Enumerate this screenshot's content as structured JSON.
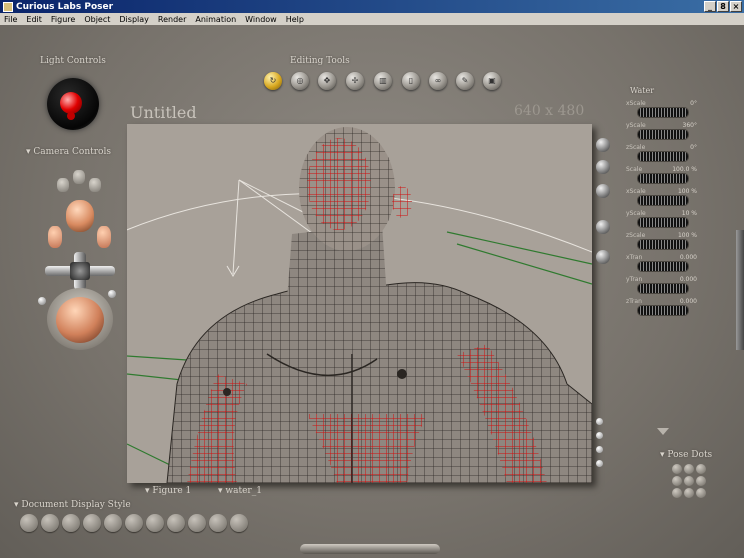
{
  "window": {
    "title": "Curious Labs Poser",
    "minimize": "_",
    "maximize": "8",
    "close": "×"
  },
  "menu": [
    "File",
    "Edit",
    "Figure",
    "Object",
    "Display",
    "Render",
    "Animation",
    "Window",
    "Help"
  ],
  "light_controls": {
    "label": "Light Controls"
  },
  "editing_tools": {
    "label": "Editing Tools",
    "tools": [
      "rotate-icon",
      "twist-icon",
      "translate-icon",
      "translate-in-out-icon",
      "scale-icon",
      "taper-icon",
      "chain-break-icon",
      "color-icon",
      "grouping-icon"
    ]
  },
  "document": {
    "title": "Untitled",
    "size": "640 x 480"
  },
  "camera_controls": {
    "label": "Camera Controls"
  },
  "parameters": {
    "label": "Water",
    "rows": [
      {
        "name": "xScale",
        "value": "0°"
      },
      {
        "name": "yScale",
        "value": "360°"
      },
      {
        "name": "zScale",
        "value": "0°"
      },
      {
        "name": "Scale",
        "value": "100.0 %"
      },
      {
        "name": "xScale",
        "value": "100 %"
      },
      {
        "name": "yScale",
        "value": "10 %"
      },
      {
        "name": "zScale",
        "value": "100 %"
      },
      {
        "name": "xTran",
        "value": "0.000"
      },
      {
        "name": "yTran",
        "value": "0.000"
      },
      {
        "name": "zTran",
        "value": "0.000"
      }
    ]
  },
  "pose_dots": {
    "label": "Pose Dots"
  },
  "document_display_style": {
    "label": "Document Display Style"
  },
  "figure_menu": "Figure 1",
  "water_menu": "water_1",
  "colors": {
    "mesh_red": "#d01010",
    "mesh_dark": "#2a2622",
    "viewport_bg": "#a8a199",
    "ground_green": "#2f7a2f"
  }
}
